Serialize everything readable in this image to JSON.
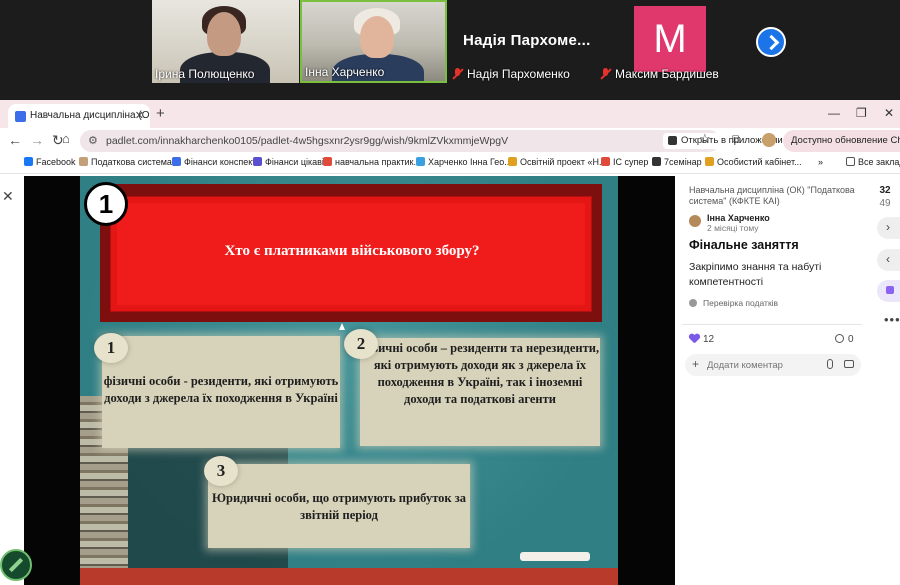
{
  "call": {
    "participants": [
      {
        "name": "Ірина Полющенко",
        "muted": false
      },
      {
        "name": "Інна Харченко",
        "muted": false
      },
      {
        "name": "Надія Пархоменко",
        "display": "Надія Пархоме...",
        "muted": true
      },
      {
        "name": "Максим Бардишев",
        "avatar_letter": "M",
        "avatar_color": "#e0386c",
        "muted": true
      }
    ]
  },
  "browser": {
    "tab_title": "Навчальна дисципліна (ОК) \"П",
    "url": "padlet.com/innakharchenko0105/padlet-4w5hgsxnr2ysr9gg/wish/9kmlZVkxmmjeWpgV",
    "open_in_app": "Открыть в приложении",
    "update": "Доступно обновление Chrome",
    "bookmarks": [
      "Facebook",
      "Податкова система...",
      "Фінанси конспект",
      "Фінанси цікаві",
      "навчальна практик...",
      "Харченко Інна Гео...",
      "Освітній проект «Н...",
      "ІС супер",
      "7семінар",
      "Особистий кабінет...",
      "Все закладки"
    ]
  },
  "slide": {
    "number": "1",
    "question": "Хто є платниками військового збору?",
    "answers": [
      {
        "num": "1",
        "text": "фізичні особи - резиденти, які отримують доходи з джерела їх походження в Україні"
      },
      {
        "num": "2",
        "text": "фізичні особи – резиденти та нерезиденти, які отримують доходи як з джерела їх походження в Україні, так і іноземні доходи та податкові агенти"
      },
      {
        "num": "3",
        "text": "Юридичні особи, що отримують прибуток за звітній період"
      }
    ]
  },
  "post": {
    "breadcrumb": "Навчальна дисципліна (ОК) \"Податкова система\" (КФКТЕ КАІ)",
    "author": "Інна Харченко",
    "time": "2 місяці тому",
    "title": "Фінальне заняття",
    "body": "Закріпимо знання та набуті компетентності",
    "tag": "Перевірка податків",
    "likes": "12",
    "comments": "0",
    "comment_placeholder": "Додати коментар"
  },
  "rail": {
    "current": "32",
    "total": "49"
  }
}
